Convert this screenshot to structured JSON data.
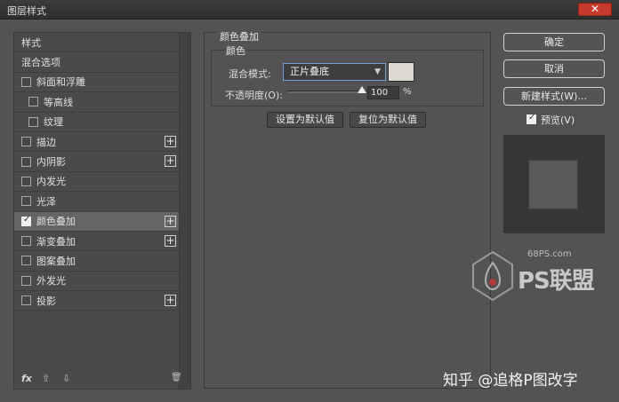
{
  "window": {
    "title": "图层样式",
    "close_label": "✕"
  },
  "sidebar": {
    "items": [
      {
        "label": "样式",
        "checkbox": false,
        "checked": false,
        "indent": false,
        "plus": false,
        "selected": false
      },
      {
        "label": "混合选项",
        "checkbox": false,
        "checked": false,
        "indent": false,
        "plus": false,
        "selected": false
      },
      {
        "label": "斜面和浮雕",
        "checkbox": true,
        "checked": false,
        "indent": false,
        "plus": false,
        "selected": false
      },
      {
        "label": "等高线",
        "checkbox": true,
        "checked": false,
        "indent": true,
        "plus": false,
        "selected": false
      },
      {
        "label": "纹理",
        "checkbox": true,
        "checked": false,
        "indent": true,
        "plus": false,
        "selected": false
      },
      {
        "label": "描边",
        "checkbox": true,
        "checked": false,
        "indent": false,
        "plus": true,
        "selected": false
      },
      {
        "label": "内阴影",
        "checkbox": true,
        "checked": false,
        "indent": false,
        "plus": true,
        "selected": false
      },
      {
        "label": "内发光",
        "checkbox": true,
        "checked": false,
        "indent": false,
        "plus": false,
        "selected": false
      },
      {
        "label": "光泽",
        "checkbox": true,
        "checked": false,
        "indent": false,
        "plus": false,
        "selected": false
      },
      {
        "label": "颜色叠加",
        "checkbox": true,
        "checked": true,
        "indent": false,
        "plus": true,
        "selected": true
      },
      {
        "label": "渐变叠加",
        "checkbox": true,
        "checked": false,
        "indent": false,
        "plus": true,
        "selected": false
      },
      {
        "label": "图案叠加",
        "checkbox": true,
        "checked": false,
        "indent": false,
        "plus": false,
        "selected": false
      },
      {
        "label": "外发光",
        "checkbox": true,
        "checked": false,
        "indent": false,
        "plus": false,
        "selected": false
      },
      {
        "label": "投影",
        "checkbox": true,
        "checked": false,
        "indent": false,
        "plus": true,
        "selected": false
      }
    ],
    "bottom": {
      "fx": "fx",
      "up": "⇧",
      "down": "⇩",
      "trash": "🗑"
    }
  },
  "panel": {
    "group_title": "颜色叠加",
    "sub_title": "颜色",
    "blend_mode_label": "混合模式:",
    "blend_mode_value": "正片叠底",
    "overlay_color": "#dcd8d2",
    "opacity_label": "不透明度(O):",
    "opacity_value": "100",
    "opacity_unit": "%",
    "set_default_label": "设置为默认值",
    "reset_default_label": "复位为默认值"
  },
  "right": {
    "ok_label": "确定",
    "cancel_label": "取消",
    "new_style_label": "新建样式(W)...",
    "preview_label": "预览(V)",
    "preview_checked": true
  },
  "watermark": {
    "site": "68PS.com",
    "ps_text": "PS联盟",
    "zhihu_text": "知乎 @追格P图改字"
  }
}
